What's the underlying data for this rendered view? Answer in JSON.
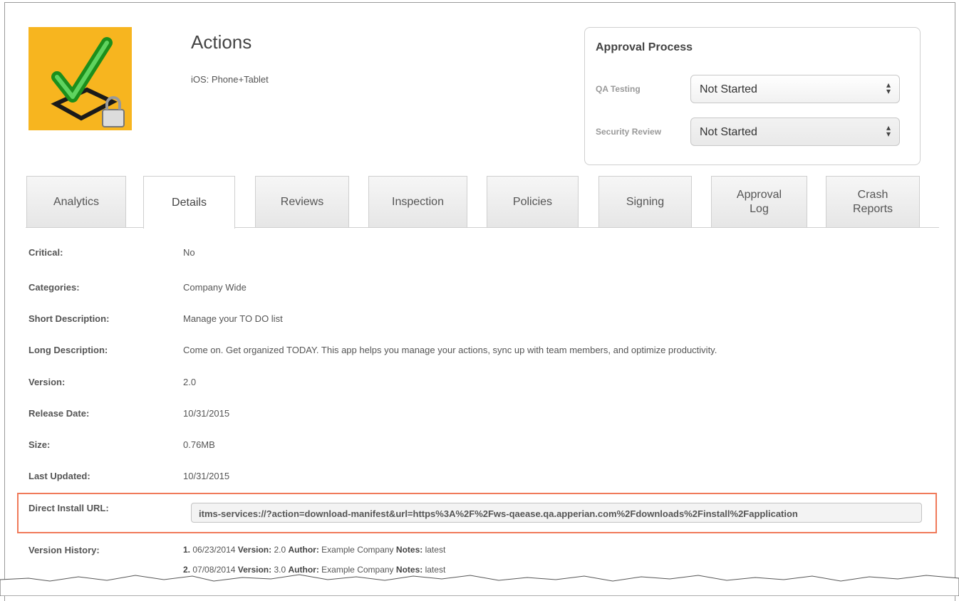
{
  "app": {
    "title": "Actions",
    "platform": "iOS: Phone+Tablet",
    "icon": "checkmark-lock-icon"
  },
  "approval": {
    "title": "Approval Process",
    "qa_label": "QA Testing",
    "qa_value": "Not Started",
    "security_label": "Security Review",
    "security_value": "Not Started"
  },
  "tabs": [
    {
      "label": "Analytics"
    },
    {
      "label": "Details"
    },
    {
      "label": "Reviews"
    },
    {
      "label": "Inspection"
    },
    {
      "label": "Policies"
    },
    {
      "label": "Signing"
    },
    {
      "label": "Approval Log"
    },
    {
      "label": "Crash Reports"
    }
  ],
  "active_tab": "Details",
  "details": [
    {
      "label": "Critical:",
      "value": "No"
    },
    {
      "label": "Categories:",
      "value": "Company Wide"
    },
    {
      "label": "Short Description:",
      "value": "Manage your TO DO list"
    },
    {
      "label": "Long Description:",
      "value": "Come on. Get organized TODAY. This app helps you manage your actions, sync up with team members, and optimize productivity."
    },
    {
      "label": "Version:",
      "value": "2.0"
    },
    {
      "label": "Release Date:",
      "value": "10/31/2015"
    },
    {
      "label": "Size:",
      "value": "0.76MB"
    },
    {
      "label": "Last Updated:",
      "value": "10/31/2015"
    }
  ],
  "direct_install": {
    "label": "Direct Install URL:",
    "value": "itms-services://?action=download-manifest&url=https%3A%2F%2Fws-qaease.qa.apperian.com%2Fdownloads%2Finstall%2Fapplication"
  },
  "version_history": {
    "label": "Version History:",
    "version_key": "Version:",
    "author_key": "Author:",
    "notes_key": "Notes:",
    "items": [
      {
        "num": "1.",
        "date": "06/23/2014",
        "version": "2.0",
        "author": "Example Company",
        "notes": "latest"
      },
      {
        "num": "2.",
        "date": "07/08/2014",
        "version": "3.0",
        "author": "Example Company",
        "notes": "latest"
      }
    ]
  }
}
